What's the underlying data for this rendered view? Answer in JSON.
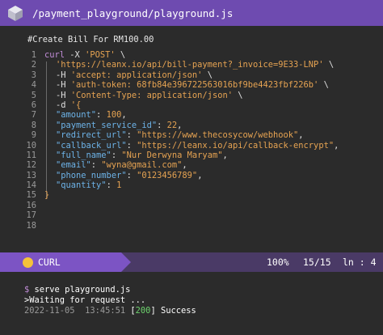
{
  "window": {
    "path": "/payment_playground/playground.js",
    "logo_icon": "cube-logo-icon"
  },
  "editor": {
    "comment": "#Create Bill For RM100.00",
    "lines": [
      {
        "n": "1",
        "segments": [
          [
            "kw",
            "curl"
          ],
          [
            "pl",
            " -X "
          ],
          [
            "str",
            "'POST'"
          ],
          [
            "pl",
            " \\"
          ]
        ]
      },
      {
        "n": "2",
        "segments": [
          [
            "str",
            "'https://leanx.io/api/bill-payment?_invoice=9E33-LNP'"
          ],
          [
            "pl",
            " \\"
          ]
        ]
      },
      {
        "n": "3",
        "segments": [
          [
            "pl",
            "-H "
          ],
          [
            "str",
            "'accept: application/json'"
          ],
          [
            "pl",
            " \\"
          ]
        ]
      },
      {
        "n": "4",
        "segments": [
          [
            "pl",
            "-H "
          ],
          [
            "str",
            "'auth-token: 68fb84e396722563016bf9be4423fbf226b'"
          ],
          [
            "pl",
            " \\"
          ]
        ]
      },
      {
        "n": "5",
        "segments": [
          [
            "pl",
            "-H "
          ],
          [
            "str",
            "'Content-Type: application/json'"
          ],
          [
            "pl",
            " \\"
          ]
        ]
      },
      {
        "n": "6",
        "segments": [
          [
            "pl",
            "-d "
          ],
          [
            "str",
            "'{"
          ]
        ]
      },
      {
        "n": "7",
        "segments": [
          [
            "key",
            "\"amount\""
          ],
          [
            "pl",
            ": "
          ],
          [
            "num",
            "100"
          ],
          [
            "pl",
            ","
          ]
        ]
      },
      {
        "n": "8",
        "segments": [
          [
            "key",
            "\"payment_service_id\""
          ],
          [
            "pl",
            ": "
          ],
          [
            "num",
            "22"
          ],
          [
            "pl",
            ","
          ]
        ]
      },
      {
        "n": "9",
        "segments": [
          [
            "key",
            "\"redirect_url\""
          ],
          [
            "pl",
            ": "
          ],
          [
            "str",
            "\"https://www.thecosycow/webhook\""
          ],
          [
            "pl",
            ","
          ]
        ]
      },
      {
        "n": "10",
        "segments": [
          [
            "key",
            "\"callback_url\""
          ],
          [
            "pl",
            ": "
          ],
          [
            "str",
            "\"https://leanx.io/api/callback-encrypt\""
          ],
          [
            "pl",
            ","
          ]
        ]
      },
      {
        "n": "11",
        "segments": [
          [
            "key",
            "\"full_name\""
          ],
          [
            "pl",
            ": "
          ],
          [
            "str",
            "\"Nur Derwyna Maryam\""
          ],
          [
            "pl",
            ","
          ]
        ]
      },
      {
        "n": "12",
        "segments": [
          [
            "key",
            "\"email\""
          ],
          [
            "pl",
            ": "
          ],
          [
            "str",
            "\"wyna@gmail.com\""
          ],
          [
            "pl",
            ","
          ]
        ]
      },
      {
        "n": "13",
        "segments": [
          [
            "key",
            "\"phone_number\""
          ],
          [
            "pl",
            ": "
          ],
          [
            "str",
            "\"0123456789\""
          ],
          [
            "pl",
            ","
          ]
        ]
      },
      {
        "n": "14",
        "segments": [
          [
            "key",
            "\"quantity\""
          ],
          [
            "pl",
            ": "
          ],
          [
            "num",
            "1"
          ]
        ]
      },
      {
        "n": "15",
        "segments": [
          [
            "str",
            "}"
          ]
        ]
      },
      {
        "n": "16",
        "segments": []
      },
      {
        "n": "17",
        "segments": []
      },
      {
        "n": "18",
        "segments": []
      }
    ]
  },
  "statusbar": {
    "language": "CURL",
    "zoom": "100%",
    "position": "15/15",
    "line_indicator": "ln : 4",
    "accent": "#7c54c4",
    "dot_color": "#f5c23a"
  },
  "terminal": {
    "prompt": "$",
    "command": "serve playground.js",
    "waiting": ">Waiting for request ...",
    "timestamp": "2022-11-05  13:45:51",
    "status_open": "[",
    "status_code": "200",
    "status_close": "]",
    "status_text": "Success"
  }
}
